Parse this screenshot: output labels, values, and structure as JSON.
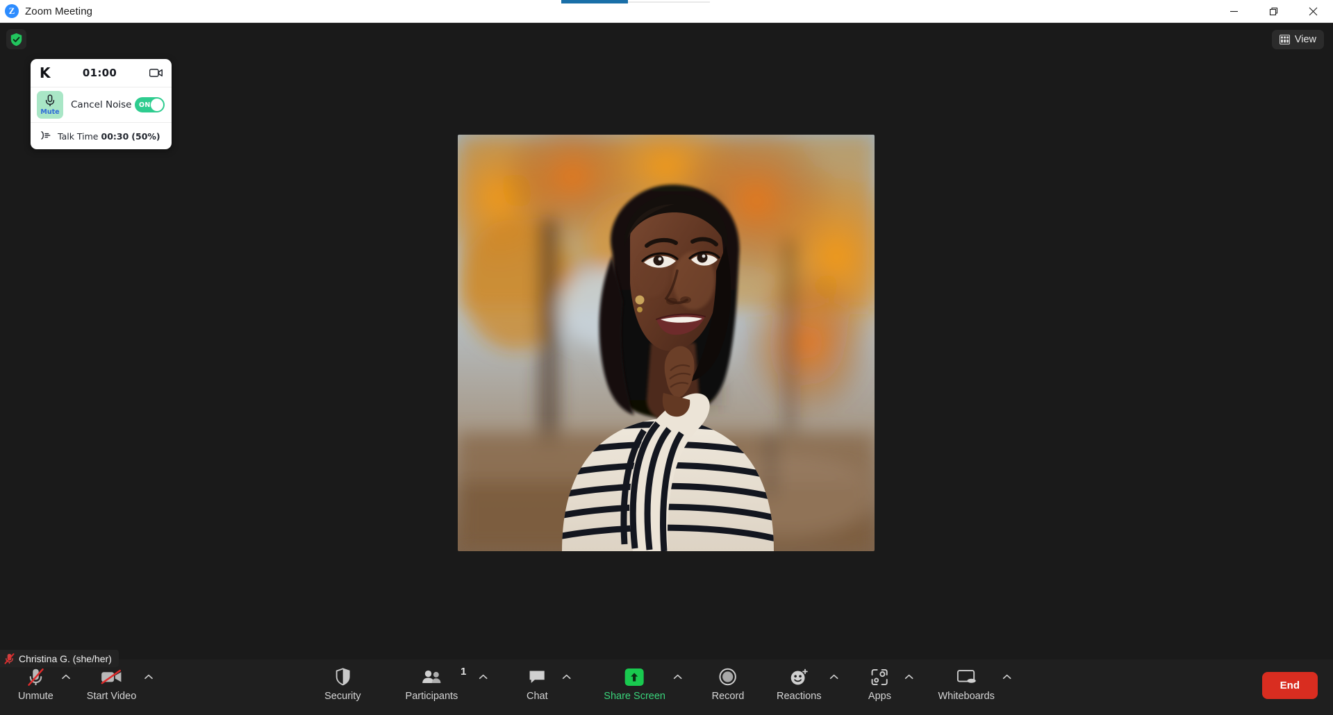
{
  "window": {
    "title": "Zoom Meeting",
    "app_icon": "zoom-logo-icon",
    "minimize_label": "Minimize",
    "restore_label": "Restore",
    "close_label": "Close",
    "accent_color": "#2d8cff"
  },
  "stage": {
    "encryption_badge": {
      "icon": "shield-check-icon",
      "color": "#2ecc71",
      "tooltip": "Encryption status"
    },
    "view_button": {
      "label": "View",
      "icon": "grid-view-icon"
    }
  },
  "krisp": {
    "logo": "K",
    "timer": "01:00",
    "camera_icon": "camera-icon",
    "mute_button": {
      "label": "Mute",
      "icon": "microphone-icon",
      "chip_color": "#a9e6c6",
      "label_color": "#2f6bd8"
    },
    "cancel_noise": {
      "label": "Cancel Noise",
      "toggle_state": "ON",
      "toggle_color": "#2ecc8f"
    },
    "talk_time": {
      "icon": "sound-wave-icon",
      "label": "Talk Time",
      "time": "00:30",
      "percent": "(50%)"
    }
  },
  "video": {
    "participant_name": "Christina G. (she/her)",
    "mic_status_icon": "microphone-muted-icon",
    "mic_status_color": "#e02b2b"
  },
  "toolbar": {
    "left": [
      {
        "name": "unmute",
        "label": "Unmute",
        "icon": "microphone-muted-icon",
        "has_chevron": true,
        "muted": true
      },
      {
        "name": "start-video",
        "label": "Start Video",
        "icon": "video-muted-icon",
        "has_chevron": true,
        "muted": true
      }
    ],
    "center": [
      {
        "name": "security",
        "label": "Security",
        "icon": "shield-icon",
        "has_chevron": false
      },
      {
        "name": "participants",
        "label": "Participants",
        "icon": "people-icon",
        "badge": "1",
        "has_chevron": true
      },
      {
        "name": "chat",
        "label": "Chat",
        "icon": "chat-bubble-icon",
        "has_chevron": true
      },
      {
        "name": "share-screen",
        "label": "Share Screen",
        "icon": "share-screen-up-arrow-icon",
        "has_chevron": true,
        "highlight_color": "#3ad47b"
      },
      {
        "name": "record",
        "label": "Record",
        "icon": "record-circle-icon",
        "has_chevron": false
      },
      {
        "name": "reactions",
        "label": "Reactions",
        "icon": "smiley-plus-icon",
        "has_chevron": true
      },
      {
        "name": "apps",
        "label": "Apps",
        "icon": "apps-icon",
        "has_chevron": true
      },
      {
        "name": "whiteboards",
        "label": "Whiteboards",
        "icon": "whiteboard-icon",
        "has_chevron": true
      }
    ],
    "end_button": {
      "label": "End",
      "color": "#d92d20"
    }
  }
}
